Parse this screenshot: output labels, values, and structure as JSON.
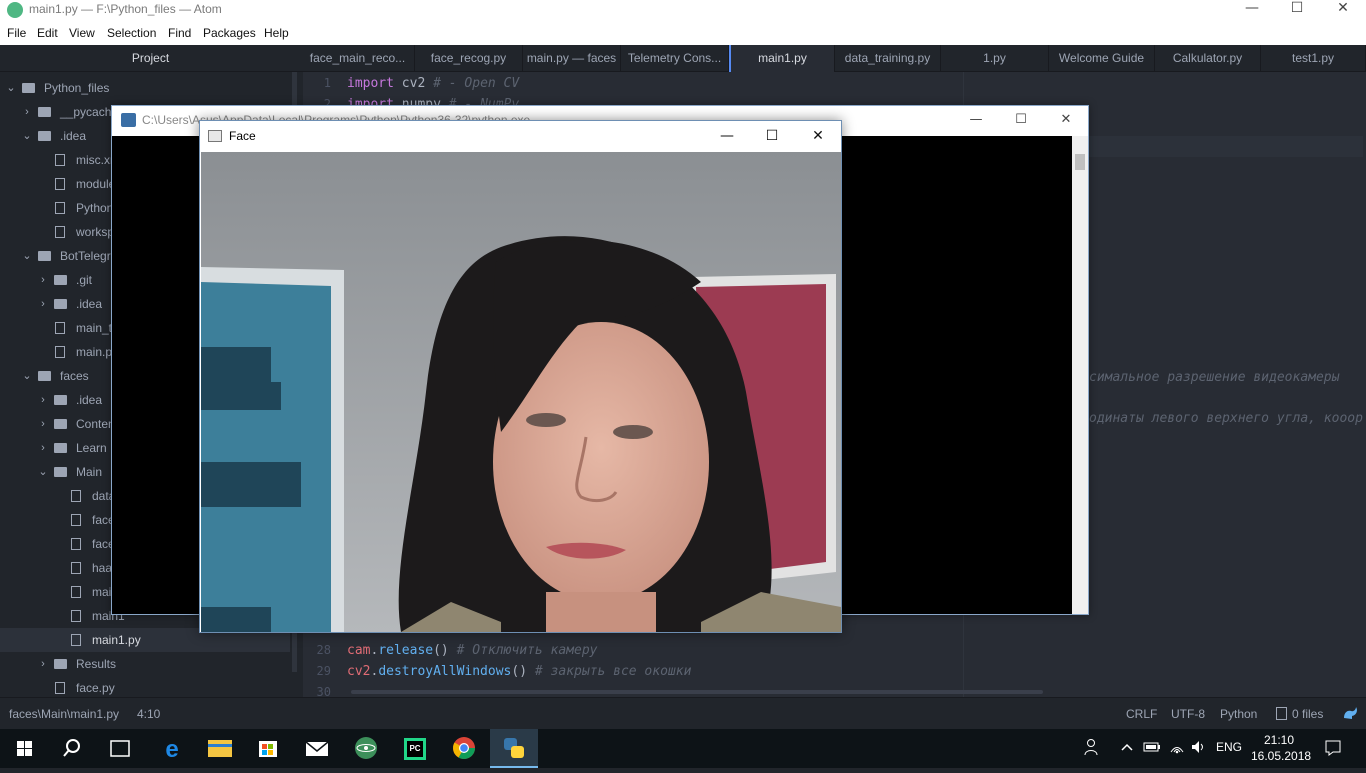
{
  "window": {
    "title": "main1.py — F:\\Python_files — Atom",
    "minimize": "—",
    "maximize": "☐",
    "close": "✕"
  },
  "menu": [
    "File",
    "Edit",
    "View",
    "Selection",
    "Find",
    "Packages",
    "Help"
  ],
  "tree": {
    "header": "Project",
    "items": [
      {
        "label": "Python_files",
        "kind": "folder",
        "expanded": true
      },
      {
        "label": "__pycache__",
        "kind": "folder",
        "expanded": false
      },
      {
        "label": ".idea",
        "kind": "folder",
        "expanded": true
      },
      {
        "label": "misc.xml",
        "kind": "file"
      },
      {
        "label": "modules.xml",
        "kind": "file"
      },
      {
        "label": "Python_files.iml",
        "kind": "file"
      },
      {
        "label": "workspace.xml",
        "kind": "file"
      },
      {
        "label": "BotTelegram",
        "kind": "folder",
        "expanded": true
      },
      {
        "label": ".git",
        "kind": "folder",
        "expanded": false
      },
      {
        "label": ".idea",
        "kind": "folder",
        "expanded": false
      },
      {
        "label": "main_telegram.py",
        "kind": "file"
      },
      {
        "label": "main.py",
        "kind": "file"
      },
      {
        "label": "faces",
        "kind": "folder",
        "expanded": true
      },
      {
        "label": ".idea",
        "kind": "folder",
        "expanded": false
      },
      {
        "label": "Content",
        "kind": "folder",
        "expanded": false
      },
      {
        "label": "Learn",
        "kind": "folder",
        "expanded": false
      },
      {
        "label": "Main",
        "kind": "folder",
        "expanded": true
      },
      {
        "label": "data_training.py",
        "kind": "file"
      },
      {
        "label": "face_main_recognition.py",
        "kind": "file"
      },
      {
        "label": "face_recog.py",
        "kind": "file"
      },
      {
        "label": "haarcascade_frontalface_default.xml",
        "kind": "file"
      },
      {
        "label": "main.py",
        "kind": "file"
      },
      {
        "label": "main1",
        "kind": "file"
      },
      {
        "label": "main1.py",
        "kind": "file",
        "selected": true
      },
      {
        "label": "Results",
        "kind": "folder",
        "expanded": false
      },
      {
        "label": "face.py",
        "kind": "file"
      }
    ]
  },
  "tabs": [
    {
      "label": "face_main_reco..."
    },
    {
      "label": "face_recog.py"
    },
    {
      "label": "main.py — faces"
    },
    {
      "label": "Telemetry Cons..."
    },
    {
      "label": "main1.py",
      "active": true
    },
    {
      "label": "data_training.py"
    },
    {
      "label": "1.py"
    },
    {
      "label": "Welcome Guide"
    },
    {
      "label": "Calkulator.py"
    },
    {
      "label": "test1.py"
    }
  ],
  "editor": {
    "line1": {
      "num": "1",
      "kw": "import",
      "mod": " cv2",
      "comment": " # - Open CV"
    },
    "line2": {
      "num": "2",
      "kw": "import",
      "mod": " numpy",
      "comment": " # - NumPy"
    },
    "line28": {
      "num": "28",
      "obj": "cam",
      "dot": ".",
      "fn": "release",
      "paren": "()",
      "comment": " # Отключить камеру"
    },
    "line29": {
      "num": "29",
      "obj": "cv2",
      "dot": ".",
      "fn": "destroyAllWindows",
      "paren": "()",
      "comment": " # закрыть все окошки"
    },
    "line30": {
      "num": "30"
    },
    "ghost1": "симальное разрешение видеокамеры",
    "ghost2": "одинаты левого верхнего угла, кооор"
  },
  "status": {
    "path": "faces\\Main\\main1.py",
    "cursor": "4:10",
    "line_ending": "CRLF",
    "encoding": "UTF-8",
    "grammar": "Python",
    "files": "0 files"
  },
  "console": {
    "title": "C:\\Users\\Asus\\AppData\\Local\\Programs\\Python\\Python36-32\\python.exe"
  },
  "face_window": {
    "title": "Face"
  },
  "taskbar": {
    "language": "ENG",
    "time": "21:10",
    "date": "16.05.2018"
  },
  "colors": {
    "accent": "#568af2",
    "editor_bg": "#282c34",
    "panel_bg": "#21252b",
    "keyword": "#c678dd",
    "function": "#61afef",
    "variable": "#e06c75",
    "comment": "#5c6370"
  }
}
